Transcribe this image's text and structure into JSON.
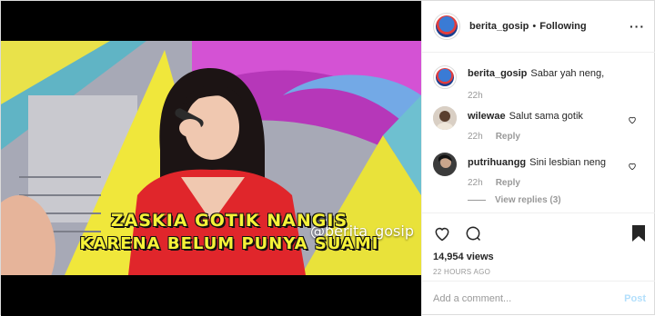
{
  "video": {
    "watermark": "@berita_gosip",
    "caption_line1": "ZASKIA GOTIK NANGIS",
    "caption_line2": "KARENA BELUM PUNYA SUAMI"
  },
  "header": {
    "username": "berita_gosip",
    "separator": "•",
    "follow_status": "Following",
    "more_icon": "more-horizontal-icon"
  },
  "comments": [
    {
      "username": "berita_gosip",
      "text": "Sabar yah neng,",
      "time": "22h",
      "reply": ""
    },
    {
      "username": "wilewae",
      "text": "Salut sama gotik",
      "time": "22h",
      "reply": "Reply"
    },
    {
      "username": "putrihuangg",
      "text": "Sini lesbian neng",
      "time": "22h",
      "reply": "Reply",
      "view_replies": "View replies (3)"
    }
  ],
  "actions": {
    "views": "14,954 views",
    "timestamp": "22 HOURS AGO"
  },
  "add_comment": {
    "placeholder": "Add a comment...",
    "post_label": "Post"
  },
  "colors": {
    "link_disabled": "#b2dffc",
    "muted": "#999999",
    "text": "#262626"
  }
}
